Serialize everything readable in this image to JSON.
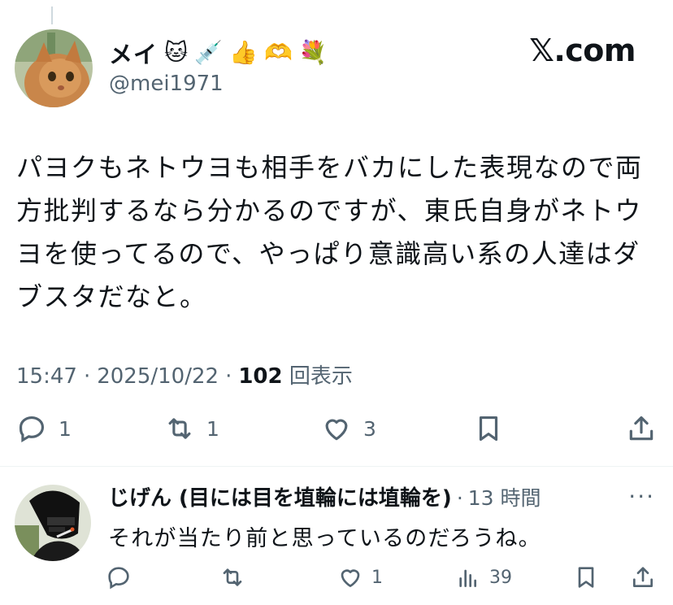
{
  "post": {
    "author": {
      "display_name": "メイ",
      "badges": [
        "🐱",
        "💉",
        "👍",
        "🫶",
        "💐"
      ],
      "handle": "@mei1971"
    },
    "brand": "𝕏.com",
    "text": "パヨクもネトウヨも相手をバカにした表現なので両方批判するなら分かるのですが、東氏自身がネトウヨを使ってるので、やっぱり意識高い系の人達はダブスタだなと。",
    "time": "15:47",
    "date": "2025/10/22",
    "separator": "·",
    "views_count": "102",
    "views_label": "回表示",
    "actions": {
      "reply_count": "1",
      "repost_count": "1",
      "like_count": "3"
    }
  },
  "reply": {
    "display_name": "じげん (目には目を埴輪には埴輪を)",
    "time_ago": "13 時間",
    "separator": "·",
    "more": "···",
    "text": "それが当たり前と思っているのだろうね。",
    "actions": {
      "like_count": "1",
      "views_count": "39"
    }
  },
  "colors": {
    "text_primary": "#0f1419",
    "text_secondary": "#536471",
    "divider": "#eff3f4"
  },
  "icons": [
    "reply-icon",
    "repost-icon",
    "like-icon",
    "bookmark-icon",
    "share-icon",
    "views-icon",
    "more-icon"
  ]
}
